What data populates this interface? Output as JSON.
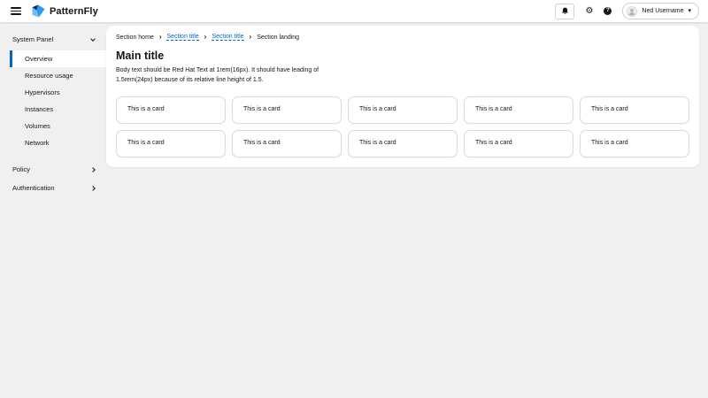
{
  "header": {
    "brand": "PatternFly",
    "user": {
      "name": "Ned Username"
    }
  },
  "icons": {
    "gear_glyph": "⚙",
    "help_glyph": "?",
    "caret_glyph": "▾",
    "breadcrumb_separator": "›"
  },
  "sidebar": {
    "sections": [
      {
        "label": "System Panel",
        "state": "expanded",
        "items": [
          {
            "label": "Overview",
            "selected": true
          },
          {
            "label": "Resource usage",
            "selected": false
          },
          {
            "label": "Hypervisors",
            "selected": false
          },
          {
            "label": "Instances",
            "selected": false
          },
          {
            "label": "Volumes",
            "selected": false
          },
          {
            "label": "Network",
            "selected": false
          }
        ]
      },
      {
        "label": "Policy",
        "state": "collapsed"
      },
      {
        "label": "Authentication",
        "state": "collapsed"
      }
    ]
  },
  "breadcrumb": [
    {
      "label": "Section home",
      "type": "text"
    },
    {
      "label": "Section title",
      "type": "link"
    },
    {
      "label": "Section title",
      "type": "link"
    },
    {
      "label": "Section landing",
      "type": "text"
    }
  ],
  "main": {
    "title": "Main title",
    "body": "Body text should be Red Hat Text at 1rem(16px). It should have leading of 1.5rem(24px) because of its relative line height of 1.5.",
    "cards": [
      "This is a card",
      "This is a card",
      "This is a card",
      "This is a card",
      "This is a card",
      "This is a card",
      "This is a card",
      "This is a card",
      "This is a card",
      "This is a card"
    ]
  },
  "colors": {
    "accent": "#0066cc",
    "page_background": "#f0f0f0",
    "text": "#151515",
    "border": "#d2d2d2"
  }
}
